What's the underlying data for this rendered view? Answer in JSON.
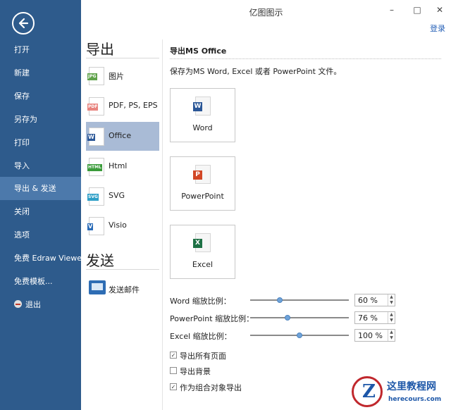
{
  "window": {
    "title": "亿图图示",
    "login_label": "登录",
    "minimize_glyph": "–",
    "maximize_glyph": "□",
    "close_glyph": "✕"
  },
  "sidebar": {
    "items": [
      {
        "label": "打开"
      },
      {
        "label": "新建"
      },
      {
        "label": "保存"
      },
      {
        "label": "另存为"
      },
      {
        "label": "打印"
      },
      {
        "label": "导入"
      },
      {
        "label": "导出 & 发送",
        "active": true
      },
      {
        "label": "关闭"
      },
      {
        "label": "选项"
      },
      {
        "label": "免费 Edraw Viewer"
      },
      {
        "label": "免费模板..."
      },
      {
        "label": "退出"
      }
    ]
  },
  "export_section": {
    "heading": "导出",
    "formats": [
      {
        "label": "图片",
        "tag": "JPG",
        "color": "#5fa24a"
      },
      {
        "label": "PDF, PS, EPS",
        "tag": "PDF",
        "color": "#d9534f"
      },
      {
        "label": "Office",
        "tag": "W",
        "color": "#2b5797",
        "active": true
      },
      {
        "label": "Html",
        "tag": "HTML",
        "color": "#3a9b3a"
      },
      {
        "label": "SVG",
        "tag": "SVG",
        "color": "#2e9fc7"
      },
      {
        "label": "Visio",
        "tag": "V",
        "color": "#2b6cb8"
      }
    ]
  },
  "send_section": {
    "heading": "发送",
    "items": [
      {
        "label": "发送邮件"
      }
    ]
  },
  "content": {
    "title": "导出MS Office",
    "description": "保存为MS Word, Excel 或者 PowerPoint 文件。",
    "cards": [
      {
        "label": "Word",
        "letter": "W",
        "color": "#2b5797"
      },
      {
        "label": "PowerPoint",
        "letter": "P",
        "color": "#d24726"
      },
      {
        "label": "Excel",
        "letter": "X",
        "color": "#1e7145"
      }
    ],
    "scales": [
      {
        "label": "Word 缩放比例：",
        "value": "60 %",
        "level": 0.3
      },
      {
        "label": "PowerPoint 缩放比例：",
        "value": "76 %",
        "level": 0.38
      },
      {
        "label": "Excel 缩放比例：",
        "value": "100 %",
        "level": 0.5
      }
    ],
    "options": [
      {
        "label": "导出所有页面",
        "checked": true,
        "mark": "✓"
      },
      {
        "label": "导出背景",
        "checked": false,
        "mark": ""
      },
      {
        "label": "作为组合对象导出",
        "checked": true,
        "mark": "✓"
      }
    ]
  },
  "watermark": {
    "logo_letter": "Z",
    "name": "这里教程网",
    "url": "herecours.com"
  }
}
